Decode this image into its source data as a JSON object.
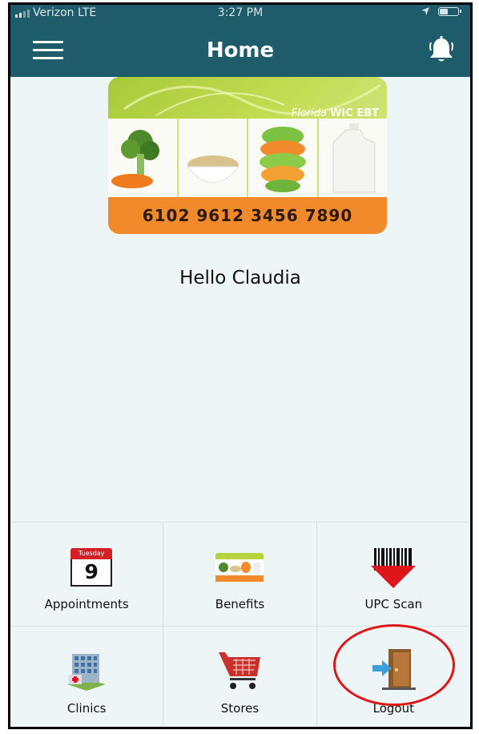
{
  "status_bar": {
    "carrier": "Verizon  LTE",
    "time": "3:27 PM"
  },
  "nav": {
    "title": "Home",
    "menu_icon": "hamburger-menu-icon",
    "alert_icon": "alarm-bell-icon"
  },
  "card": {
    "brand_prefix": "Florida ",
    "brand_name": "WIC EBT",
    "number": "6102 9612 3456 7890"
  },
  "greeting": "Hello Claudia",
  "tiles": [
    {
      "label": "Appointments",
      "icon": "calendar-icon",
      "calendar_day": "Tuesday",
      "calendar_date": "9"
    },
    {
      "label": "Benefits",
      "icon": "wic-card-icon"
    },
    {
      "label": "UPC Scan",
      "icon": "barcode-scan-icon"
    },
    {
      "label": "Clinics",
      "icon": "clinic-building-icon"
    },
    {
      "label": "Stores",
      "icon": "shopping-cart-icon"
    },
    {
      "label": "Logout",
      "icon": "logout-door-icon"
    }
  ],
  "colors": {
    "nav_bg": "#1f5c6b",
    "page_bg": "#eef5f6",
    "card_orange": "#f08a2a",
    "card_green": "#a8c93a",
    "highlight": "#e01515"
  }
}
